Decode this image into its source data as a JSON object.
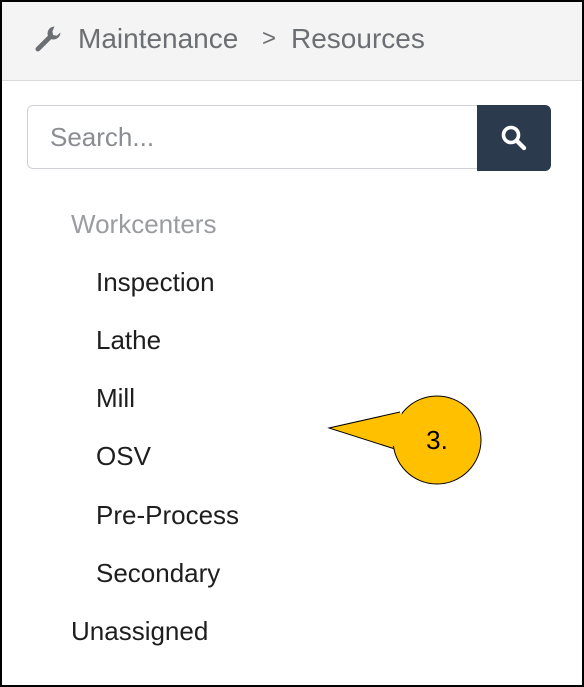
{
  "breadcrumb": {
    "icon": "wrench-icon",
    "items": [
      "Maintenance",
      "Resources"
    ],
    "separator": ">"
  },
  "search": {
    "placeholder": "Search...",
    "value": "",
    "button_icon": "search-icon",
    "button_color": "#2c3a4d"
  },
  "tree": {
    "group_label": "Workcenters",
    "children": [
      "Inspection",
      "Lathe",
      "Mill",
      "OSV",
      "Pre-Process",
      "Secondary"
    ],
    "unassigned_label": "Unassigned"
  },
  "callout": {
    "label": "3.",
    "fill_color": "#ffc000"
  }
}
